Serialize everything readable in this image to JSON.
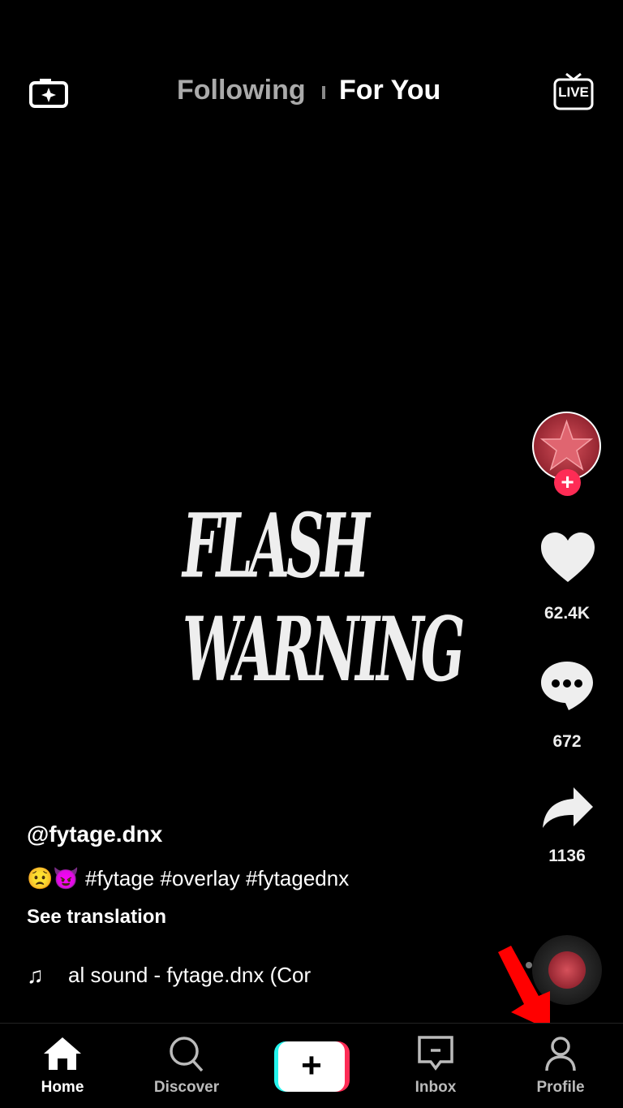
{
  "top_nav": {
    "tabs": [
      {
        "label": "Following",
        "active": false
      },
      {
        "label": "For You",
        "active": true
      }
    ],
    "left_icon": "camera-sparkle-icon",
    "right_icon": "live-icon",
    "live_label": "LIVE"
  },
  "video": {
    "overlay_text": "FLASH WARNING"
  },
  "side_actions": {
    "avatar_icon": "red-star-avatar",
    "follow_icon": "plus-icon",
    "likes": "62.4K",
    "comments": "672",
    "shares": "1136"
  },
  "caption": {
    "username": "@fytage.dnx",
    "emojis": "😟😈",
    "hashtags": "#fytage #overlay #fytagednx",
    "see_translation": "See translation",
    "sound": "al sound - fytage.dnx (Cor"
  },
  "bottom_nav": {
    "items": [
      {
        "label": "Home",
        "active": true
      },
      {
        "label": "Discover"
      },
      {
        "label": "Inbox"
      },
      {
        "label": "Profile"
      }
    ]
  },
  "colors": {
    "accent_red": "#fe2c55",
    "accent_cyan": "#25f4ee",
    "annotation_arrow": "#ff0000"
  }
}
